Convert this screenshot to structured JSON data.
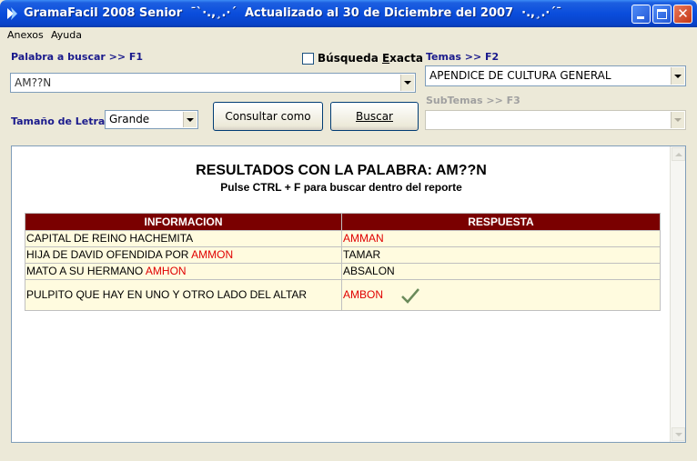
{
  "window": {
    "title": "GramaFacil 2008 Senior  ¯`·.,¸.·´  Actualizado al 30 de Diciembre del 2007  ·.,¸.·´¯",
    "controls": [
      "minimize",
      "maximize",
      "close"
    ]
  },
  "menu": {
    "items": [
      "Anexos",
      "Ayuda"
    ]
  },
  "search": {
    "label": "Palabra a buscar >> F1",
    "value": "AM??N",
    "exact_label": "Búsqueda Exacta",
    "exact_checked": false
  },
  "temas": {
    "label": "Temas >> F2",
    "value": "APENDICE DE CULTURA GENERAL"
  },
  "subtemas": {
    "label": "SubTemas >> F3",
    "value": ""
  },
  "font_size": {
    "label": "Tamaño de Letra",
    "value": "Grande"
  },
  "buttons": {
    "consultar": "Consultar como",
    "buscar": "Buscar"
  },
  "report": {
    "title": "RESULTADOS CON LA PALABRA: AM??N",
    "subtitle": "Pulse CTRL + F para buscar dentro del reporte",
    "columns": [
      "INFORMACION",
      "RESPUESTA"
    ],
    "rows": [
      {
        "info": "CAPITAL DE REINO HACHEMITA",
        "info_highlight": "",
        "answer": "AMMAN",
        "answer_red": true,
        "check": false
      },
      {
        "info": "HIJA DE DAVID OFENDIDA POR ",
        "info_highlight": "AMMON",
        "answer": "TAMAR",
        "answer_red": false,
        "check": false
      },
      {
        "info": "MATO A SU HERMANO ",
        "info_highlight": "AMHON",
        "answer": "ABSALON",
        "answer_red": false,
        "check": false
      },
      {
        "info": "PULPITO QUE HAY EN UNO Y OTRO LADO DEL ALTAR",
        "info_highlight": "",
        "answer": "AMBON",
        "answer_red": true,
        "check": true
      }
    ]
  },
  "colors": {
    "header_bg": "#7a0000",
    "row_bg": "#fffbdf",
    "highlight": "#e00000",
    "label_blue": "#1a1a8c"
  }
}
